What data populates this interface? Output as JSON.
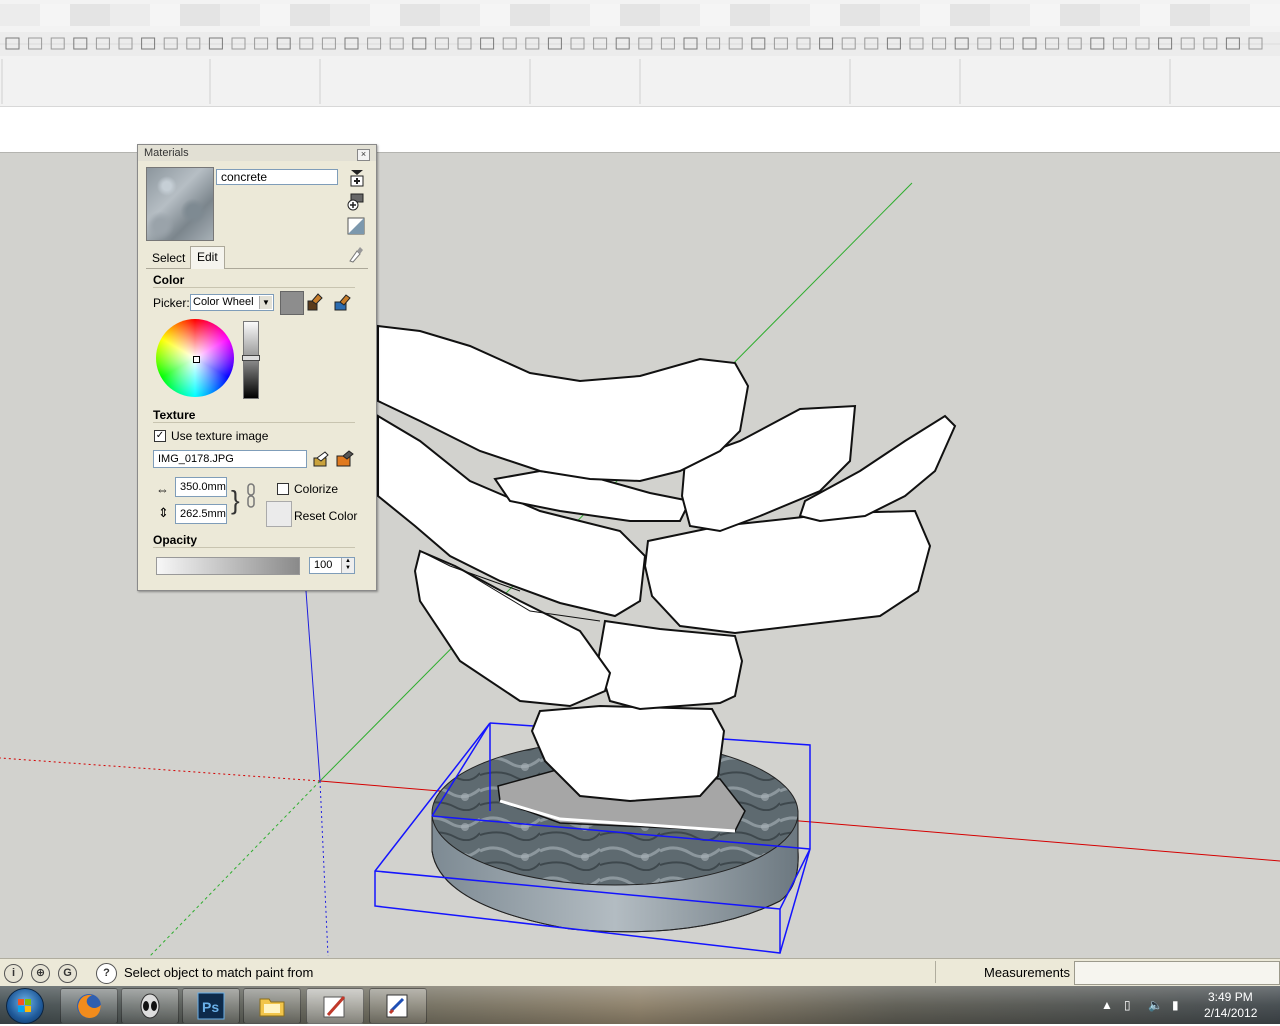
{
  "materials": {
    "title": "Materials",
    "material_name": "concrete",
    "tab_select": "Select",
    "tab_edit": "Edit",
    "color_header": "Color",
    "picker_label": "Picker:",
    "picker_value": "Color Wheel",
    "swatch_color": "#8d8d8d",
    "texture_header": "Texture",
    "use_texture_label": "Use texture image",
    "use_texture_checked": true,
    "texture_file": "IMG_0178.JPG",
    "width": "350.0mm",
    "height": "262.5mm",
    "colorize_label": "Colorize",
    "colorize_checked": false,
    "reset_color_label": "Reset Color",
    "opacity_header": "Opacity",
    "opacity_value": "100",
    "opacity_level": 1.0
  },
  "statusbar": {
    "hint": "Select object to match paint from",
    "measurements_label": "Measurements",
    "measurements_value": ""
  },
  "taskbar": {
    "apps": [
      "firefox",
      "alien",
      "photoshop",
      "explorer",
      "sketchup",
      "paint"
    ],
    "time": "3:49 PM",
    "date": "2/14/2012"
  },
  "icons": {
    "help": "question-icon",
    "check": "✓"
  }
}
